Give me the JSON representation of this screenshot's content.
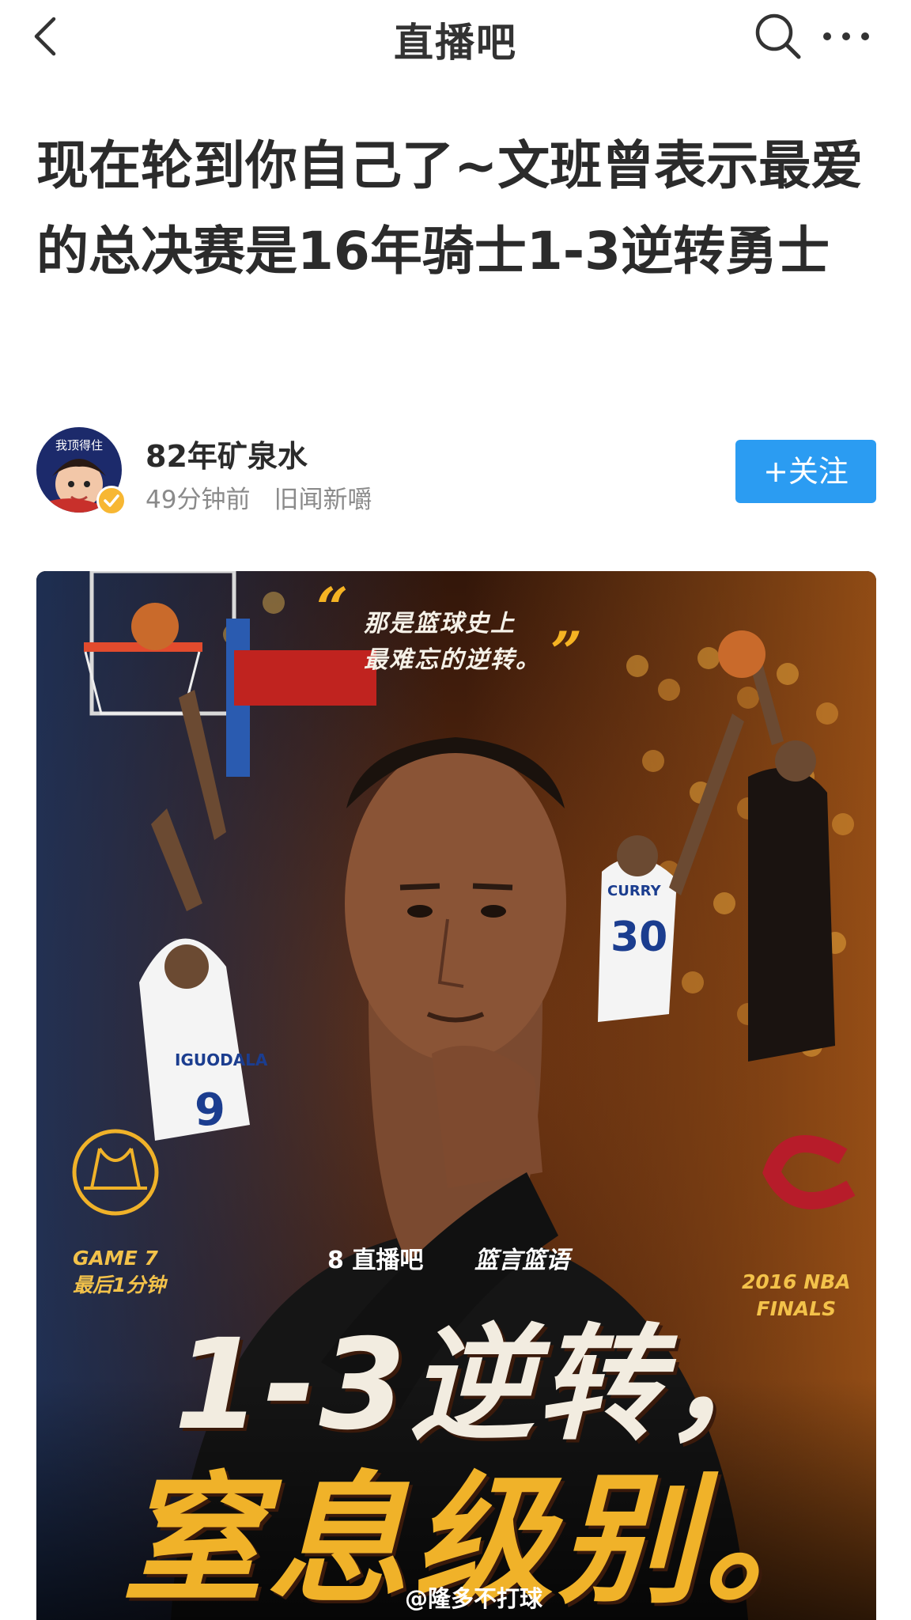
{
  "nav": {
    "title": "直播吧",
    "back_icon": "chevron-left-icon",
    "search_icon": "search-icon",
    "more_icon": "more-horizontal-icon"
  },
  "article": {
    "title": "现在轮到你自己了~文班曾表示最爱的总决赛是16年骑士1-3逆转勇士"
  },
  "author": {
    "name": "82年矿泉水",
    "avatar_text": "我顶得住",
    "time": "49分钟前",
    "source": "旧闻新嚼",
    "follow_label": "+关注",
    "verified": true
  },
  "poster": {
    "quote_line1": "那是篮球史上",
    "quote_line2": "最难忘的逆转。",
    "left_label_line1": "GAME 7",
    "left_label_line2": "最后1分钟",
    "right_label_line1": "2016 NBA",
    "right_label_line2": "FINALS",
    "brand": "8 直播吧",
    "brand_sub": "篮言篮语",
    "headline_line1": "1-3逆转，",
    "headline_line2": "窒息级别。",
    "watermark": "@隆多不打球",
    "jersey_left": "9",
    "jersey_right": "30",
    "jersey_left_name": "IGUODALA",
    "jersey_right_name": "CURRY"
  },
  "colors": {
    "accent": "#2b9cf2",
    "title_text": "#2b2b2b",
    "meta_text": "#8a8a8a",
    "poster_gold": "#f0b229",
    "verified": "#f7b733"
  }
}
